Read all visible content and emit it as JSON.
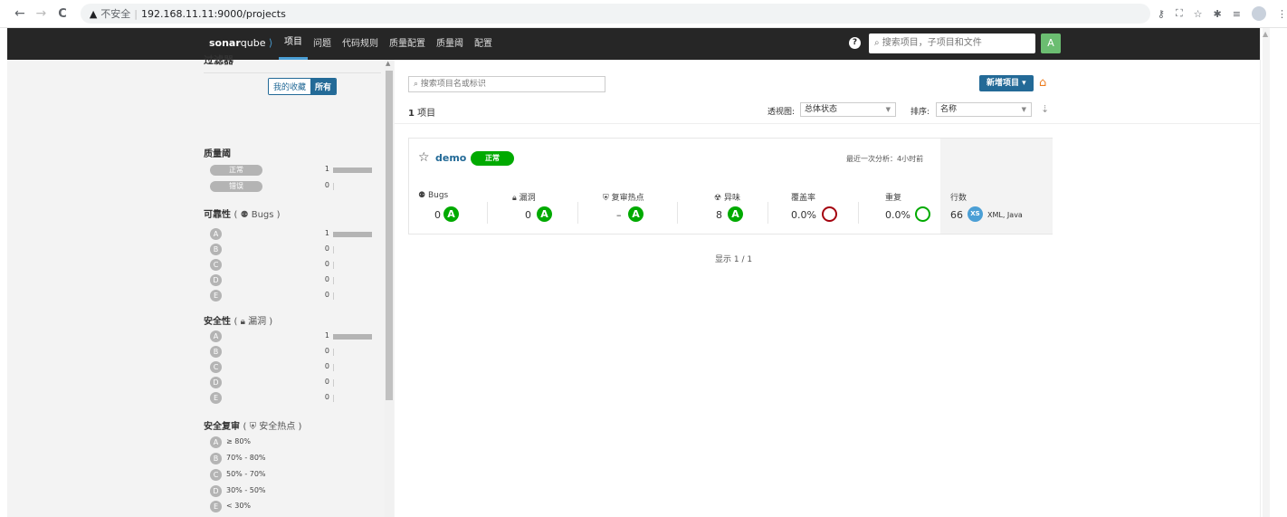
{
  "browser": {
    "back": "←",
    "forward": "→",
    "reload": "C",
    "security_label": "不安全",
    "url": "192.168.11.11:9000/projects"
  },
  "nav": {
    "logo_bold": "sonar",
    "logo_light": "qube",
    "menu": [
      "项目",
      "问题",
      "代码规则",
      "质量配置",
      "质量阈",
      "配置"
    ],
    "search_placeholder": "搜索项目，子项目和文件",
    "avatar": "A"
  },
  "sidebar": {
    "favorites": "我的收藏",
    "all": "所有",
    "filter_title": "过滤器",
    "quality_gate": {
      "title": "质量阈",
      "items": [
        {
          "label": "正常",
          "count": "1",
          "fraction": 1
        },
        {
          "label": "错误",
          "count": "0",
          "fraction": 0
        }
      ]
    },
    "reliability": {
      "title": "可靠性",
      "sub": "Bugs",
      "items": [
        {
          "grade": "A",
          "count": "1",
          "fraction": 1
        },
        {
          "grade": "B",
          "count": "0",
          "fraction": 0
        },
        {
          "grade": "C",
          "count": "0",
          "fraction": 0
        },
        {
          "grade": "D",
          "count": "0",
          "fraction": 0
        },
        {
          "grade": "E",
          "count": "0",
          "fraction": 0
        }
      ]
    },
    "security": {
      "title": "安全性",
      "sub": "漏洞",
      "items": [
        {
          "grade": "A",
          "count": "1",
          "fraction": 1
        },
        {
          "grade": "B",
          "count": "0",
          "fraction": 0
        },
        {
          "grade": "C",
          "count": "0",
          "fraction": 0
        },
        {
          "grade": "D",
          "count": "0",
          "fraction": 0
        },
        {
          "grade": "E",
          "count": "0",
          "fraction": 0
        }
      ]
    },
    "security_review": {
      "title": "安全复审",
      "sub": "安全热点",
      "items": [
        {
          "grade": "A",
          "range": "≥ 80%"
        },
        {
          "grade": "B",
          "range": "70% - 80%"
        },
        {
          "grade": "C",
          "range": "50% - 70%"
        },
        {
          "grade": "D",
          "range": "30% - 50%"
        },
        {
          "grade": "E",
          "range": "< 30%"
        }
      ]
    }
  },
  "main": {
    "search_placeholder": "搜索项目名或标识",
    "new_project": "新增项目 ▾",
    "project_count": "1",
    "project_count_label": "项目",
    "perspective_label": "透视图:",
    "perspective_value": "总体状态",
    "sort_label": "排序:",
    "sort_value": "名称",
    "pagination": "显示 1 / 1"
  },
  "project": {
    "name": "demo",
    "status": "正常",
    "last_analysis": "最近一次分析：4小时前",
    "metrics": {
      "bugs": {
        "label": "Bugs",
        "value": "0",
        "rating": "A"
      },
      "vulnerabilities": {
        "label": "漏洞",
        "value": "0",
        "rating": "A"
      },
      "hotspots": {
        "label": "复审热点",
        "value": "–",
        "rating": "A"
      },
      "smells": {
        "label": "异味",
        "value": "8",
        "rating": "A"
      },
      "coverage": {
        "label": "覆盖率",
        "value": "0.0%"
      },
      "duplications": {
        "label": "重复",
        "value": "0.0%"
      },
      "lines": {
        "label": "行数",
        "value": "66",
        "size": "XS",
        "languages": "XML, Java"
      }
    }
  },
  "colors": {
    "rating_a": "#00aa00",
    "coverage_ring": "#a4030f",
    "duplication_ring": "#00aa00",
    "brand_blue": "#236a97",
    "home_orange": "#ed7d20"
  }
}
